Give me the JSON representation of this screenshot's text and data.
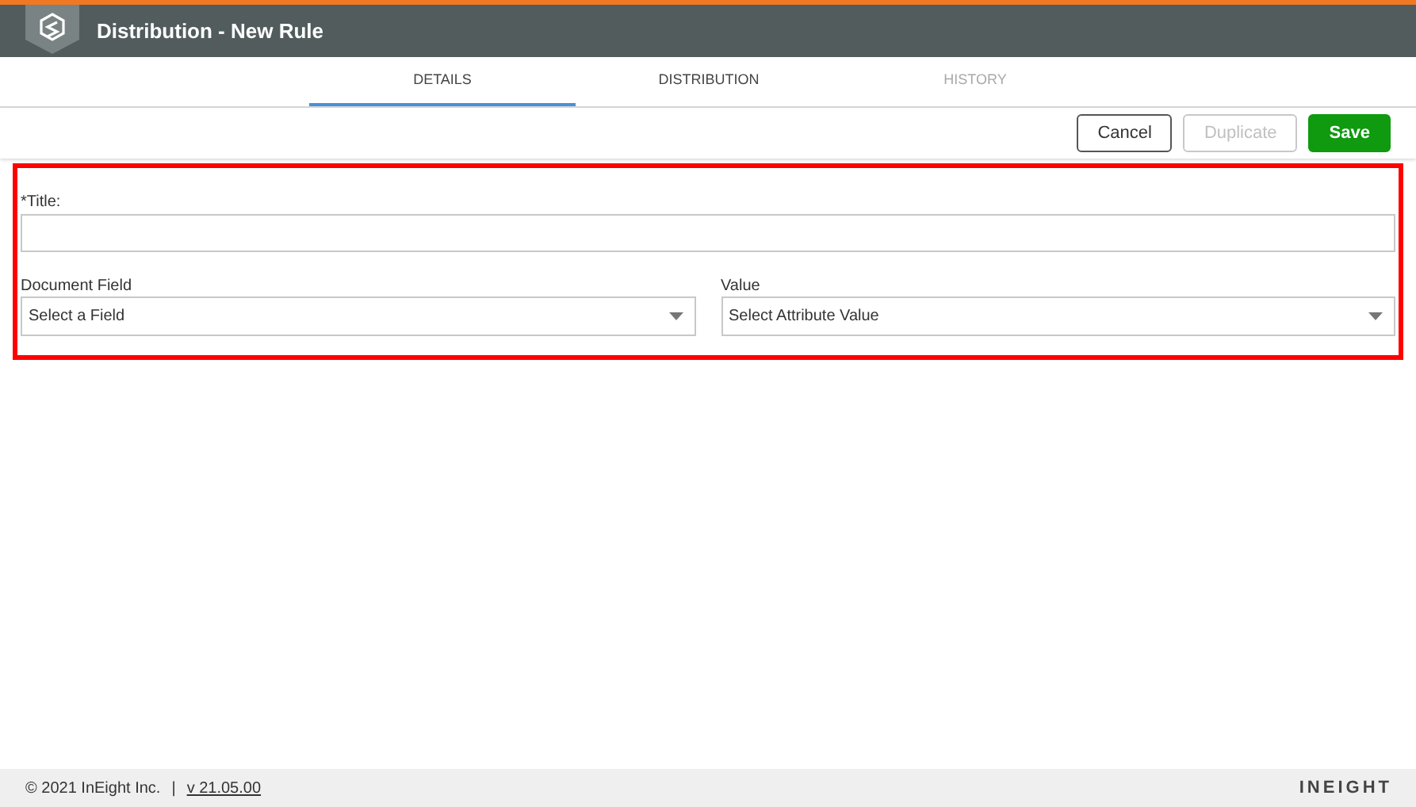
{
  "window": {
    "title": "Distribution - New Rule"
  },
  "tabs": [
    {
      "label": "DETAILS",
      "selected": true,
      "disabled": false
    },
    {
      "label": "DISTRIBUTION",
      "selected": false,
      "disabled": false
    },
    {
      "label": "HISTORY",
      "selected": false,
      "disabled": true
    }
  ],
  "buttons": [
    {
      "label": "Cancel",
      "kind": "secondary",
      "disabled": false
    },
    {
      "label": "Duplicate",
      "kind": "secondary",
      "disabled": true
    },
    {
      "label": "Save",
      "kind": "primary",
      "disabled": false
    }
  ],
  "form": {
    "title_label": "*Title:",
    "selects": [
      {
        "label": "Document Field",
        "placeholder": "Select a Field"
      },
      {
        "label": "Value",
        "placeholder": "Select Attribute Value"
      }
    ]
  },
  "footer": {
    "copyright": "© 2021 InEight Inc.",
    "separator": "|",
    "version": "v 21.05.00",
    "brand": "INEIGHT"
  }
}
